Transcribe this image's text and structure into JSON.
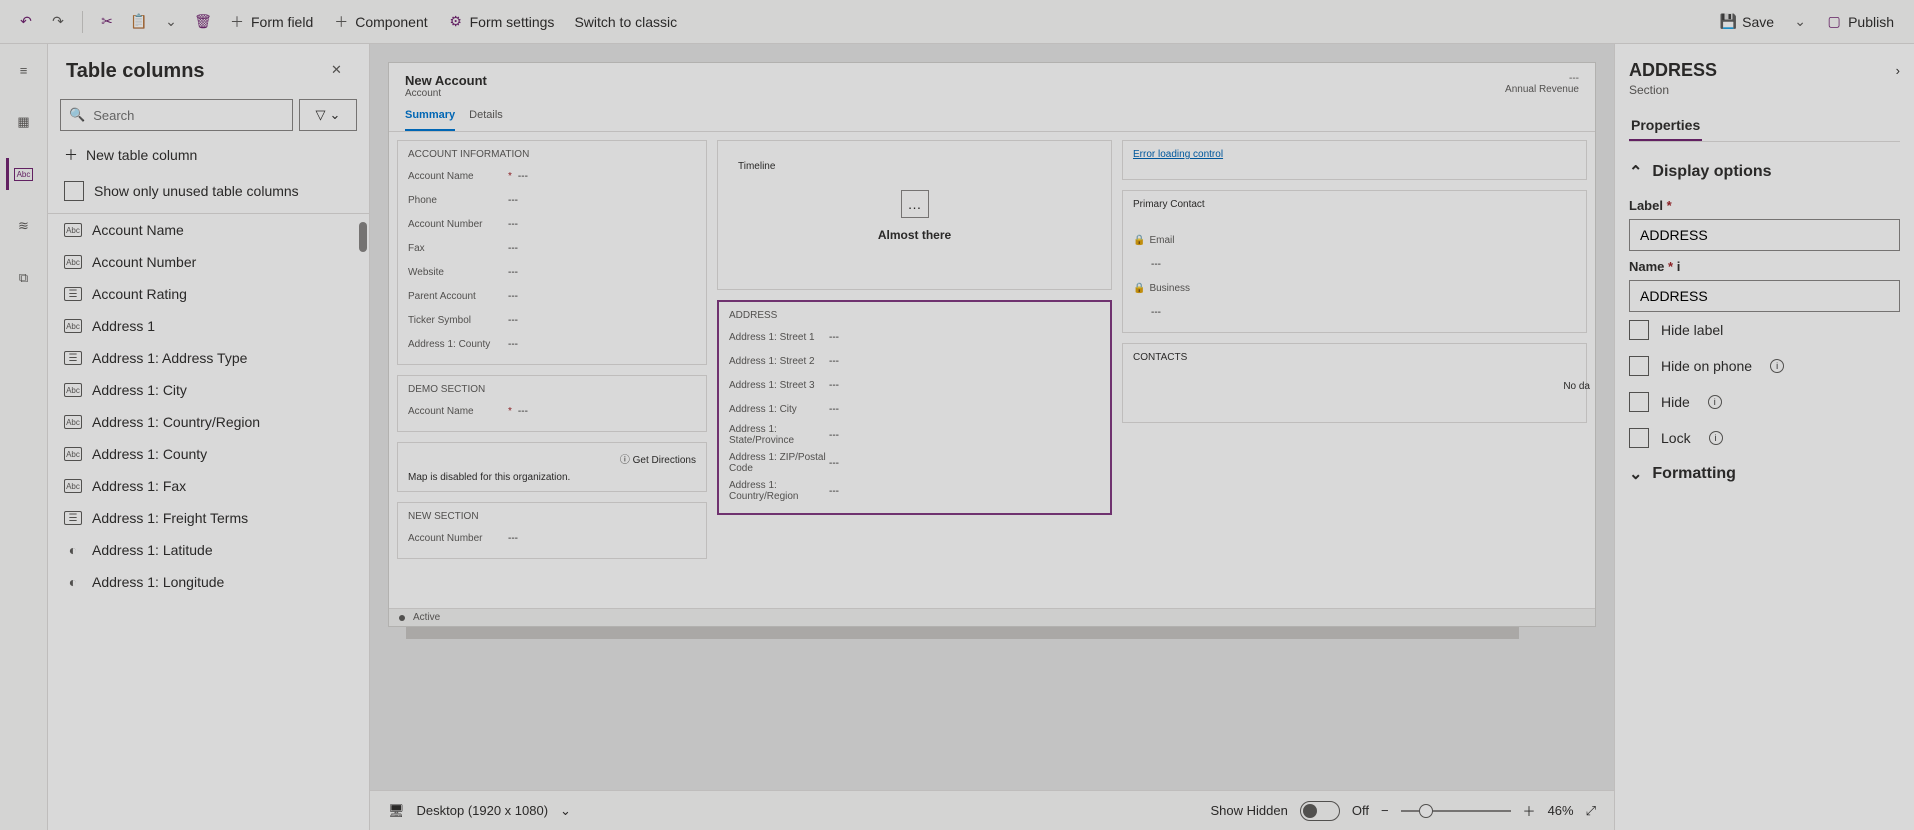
{
  "toolbar": {
    "form_field": "Form field",
    "component": "Component",
    "form_settings": "Form settings",
    "switch_classic": "Switch to classic",
    "save": "Save",
    "publish": "Publish"
  },
  "panel": {
    "title": "Table columns",
    "search_placeholder": "Search",
    "new_column": "New table column",
    "show_unused": "Show only unused table columns",
    "columns": [
      {
        "type": "Abc",
        "label": "Account Name"
      },
      {
        "type": "Abc",
        "label": "Account Number"
      },
      {
        "type": "opt",
        "label": "Account Rating"
      },
      {
        "type": "Abc\ndef",
        "label": "Address 1"
      },
      {
        "type": "opt",
        "label": "Address 1: Address Type"
      },
      {
        "type": "Abc",
        "label": "Address 1: City"
      },
      {
        "type": "Abc",
        "label": "Address 1: Country/Region"
      },
      {
        "type": "Abc",
        "label": "Address 1: County"
      },
      {
        "type": "Abc",
        "label": "Address 1: Fax"
      },
      {
        "type": "opt",
        "label": "Address 1: Freight Terms"
      },
      {
        "type": "geo",
        "label": "Address 1: Latitude"
      },
      {
        "type": "geo",
        "label": "Address 1: Longitude"
      }
    ]
  },
  "form": {
    "title": "New Account",
    "subtitle": "Account",
    "kpi": "Annual Revenue",
    "tabs": [
      "Summary",
      "Details"
    ],
    "sections": {
      "account_info": {
        "title": "ACCOUNT INFORMATION",
        "fields": [
          {
            "label": "Account Name",
            "req": true,
            "val": "---"
          },
          {
            "label": "Phone",
            "req": false,
            "val": "---"
          },
          {
            "label": "Account Number",
            "req": false,
            "val": "---"
          },
          {
            "label": "Fax",
            "req": false,
            "val": "---"
          },
          {
            "label": "Website",
            "req": false,
            "val": "---"
          },
          {
            "label": "Parent Account",
            "req": false,
            "val": "---"
          },
          {
            "label": "Ticker Symbol",
            "req": false,
            "val": "---"
          },
          {
            "label": "Address 1: County",
            "req": false,
            "val": "---"
          }
        ]
      },
      "demo": {
        "title": "Demo Section",
        "fields": [
          {
            "label": "Account Name",
            "req": true,
            "val": "---"
          }
        ]
      },
      "map": {
        "action": "Get Directions",
        "note": "Map is disabled for this organization."
      },
      "new_section": {
        "title": "New Section",
        "fields": [
          {
            "label": "Account Number",
            "req": false,
            "val": "---"
          }
        ]
      },
      "timeline": {
        "title": "Timeline",
        "text": "Almost there"
      },
      "address": {
        "title": "ADDRESS",
        "fields": [
          {
            "label": "Address 1: Street 1",
            "val": "---"
          },
          {
            "label": "Address 1: Street 2",
            "val": "---"
          },
          {
            "label": "Address 1: Street 3",
            "val": "---"
          },
          {
            "label": "Address 1: City",
            "val": "---"
          },
          {
            "label": "Address 1: State/Province",
            "val": "---"
          },
          {
            "label": "Address 1: ZIP/Postal Code",
            "val": "---"
          },
          {
            "label": "Address 1: Country/Region",
            "val": "---"
          }
        ]
      },
      "right_err": "Error loading control",
      "primary_contact": {
        "title": "Primary Contact",
        "fields": [
          {
            "label": "Email",
            "val": "---"
          },
          {
            "label": "Business",
            "val": "---"
          }
        ]
      },
      "contacts": {
        "title": "CONTACTS",
        "nodata": "No da"
      }
    },
    "footer_status": "Active"
  },
  "canvas_footer": {
    "device": "Desktop (1920 x 1080)",
    "show_hidden": "Show Hidden",
    "toggle_label": "Off",
    "zoom": "46%"
  },
  "props": {
    "title": "ADDRESS",
    "subtitle": "Section",
    "tab": "Properties",
    "group": "Display options",
    "label_field": "Label",
    "label_value": "ADDRESS",
    "name_field": "Name",
    "name_value": "ADDRESS",
    "chk_hide_label": "Hide label",
    "chk_hide_phone": "Hide on phone",
    "chk_hide": "Hide",
    "chk_lock": "Lock",
    "formatting": "Formatting"
  }
}
